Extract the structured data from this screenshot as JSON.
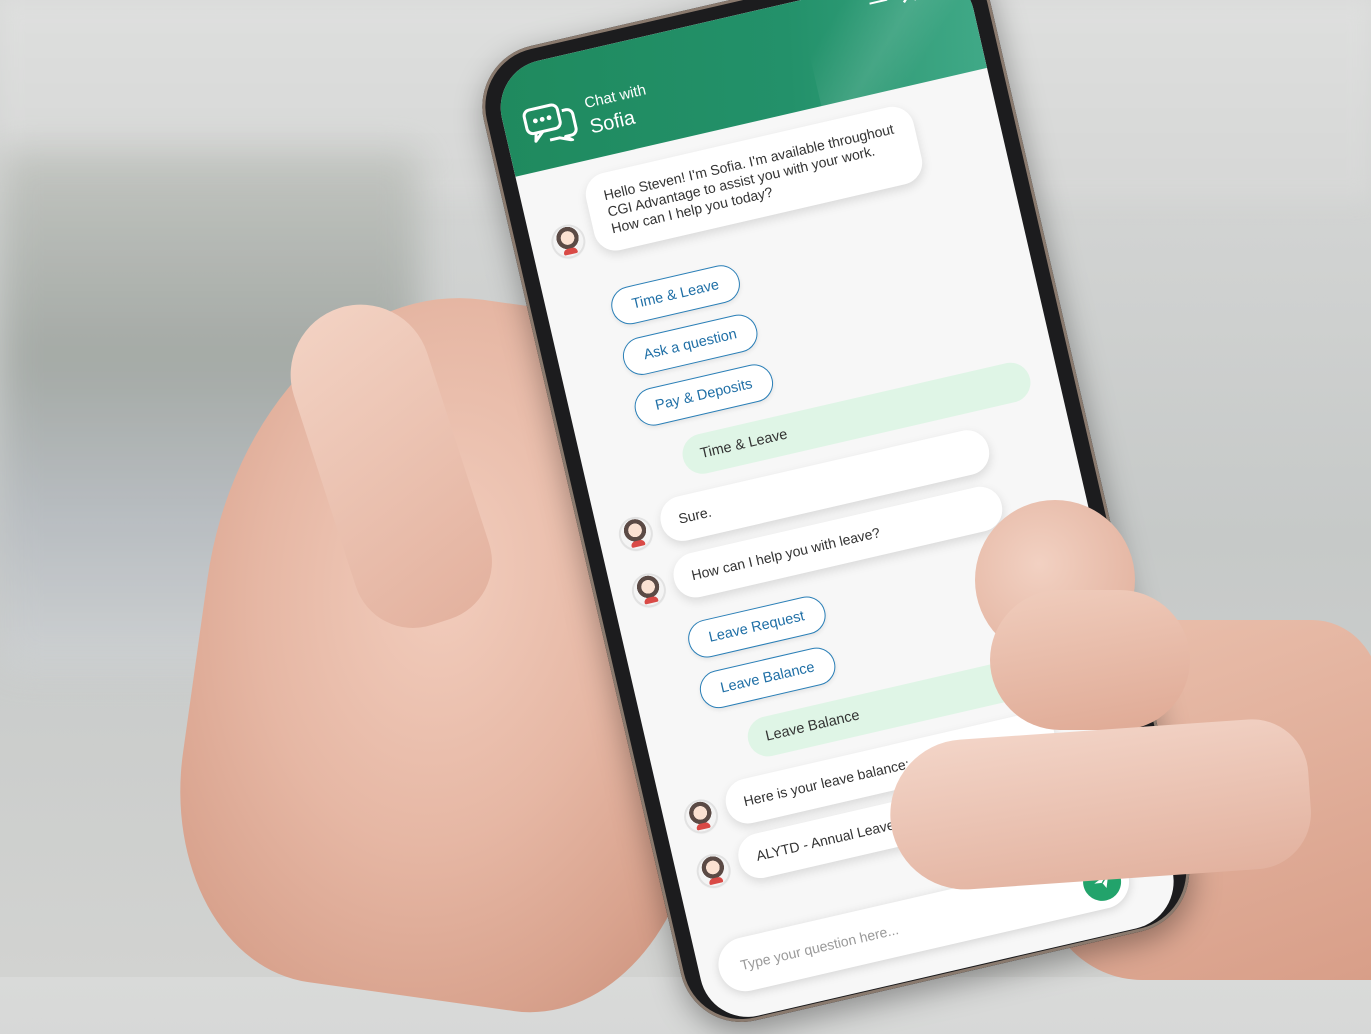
{
  "header": {
    "subtitle": "Chat with",
    "title": "Sofia",
    "minimize_icon": "minimize-icon",
    "close_icon": "close-icon"
  },
  "messages": {
    "greeting": "Hello Steven! I'm Sofia. I'm available throughout CGI Advantage to assist you with your work. How can I help you today?",
    "sure": "Sure.",
    "leave_help": "How can I help you with leave?",
    "balance_intro": "Here is your leave balance:",
    "balance_value": "ALYTD - Annual Leave: 368:04 hours"
  },
  "options_main": [
    "Time & Leave",
    "Ask a question",
    "Pay & Deposits"
  ],
  "user_reply_1": "Time & Leave",
  "options_leave": [
    "Leave Request",
    "Leave Balance"
  ],
  "user_reply_2": "Leave Balance",
  "input": {
    "placeholder": "Type your question here...",
    "send_icon": "send-icon"
  },
  "colors": {
    "header_green": "#1f8a5e",
    "user_bubble": "#dff5e6",
    "chip_border": "#2a7fb7",
    "send_button": "#22a36b"
  }
}
